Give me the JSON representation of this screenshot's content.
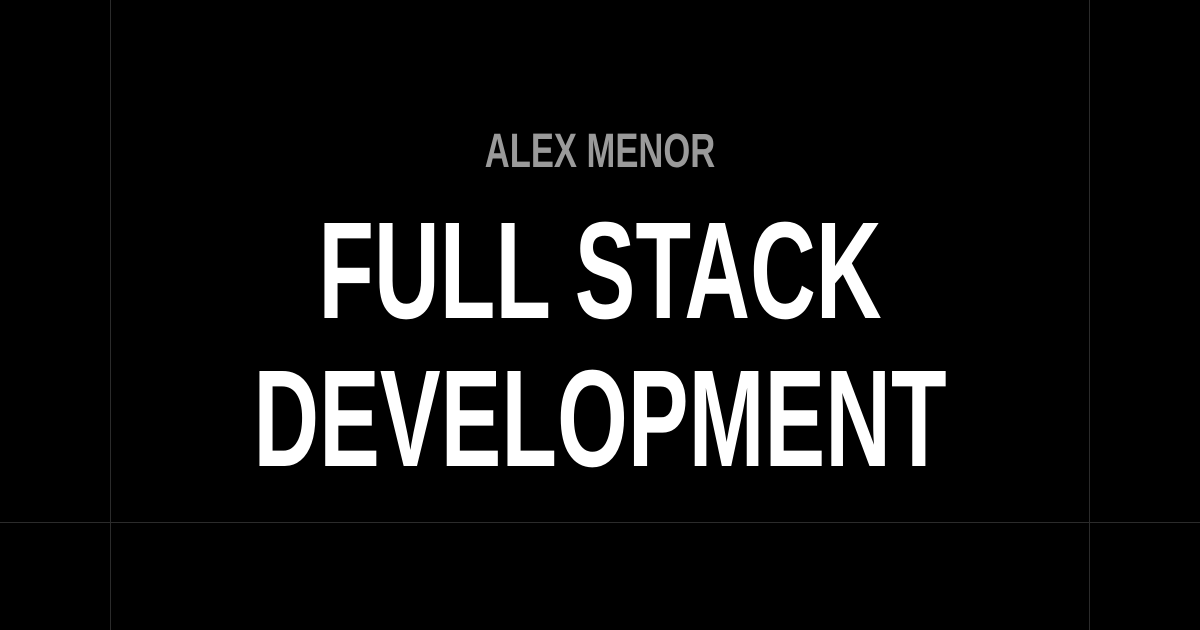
{
  "author": "ALEX MENOR",
  "headline": {
    "line1": "FULL STACK",
    "line2": "DEVELOPMENT"
  },
  "colors": {
    "background": "#000000",
    "author_text": "#9a9a9a",
    "headline_text": "#ffffff",
    "guide_lines": "#2b2b2b"
  }
}
